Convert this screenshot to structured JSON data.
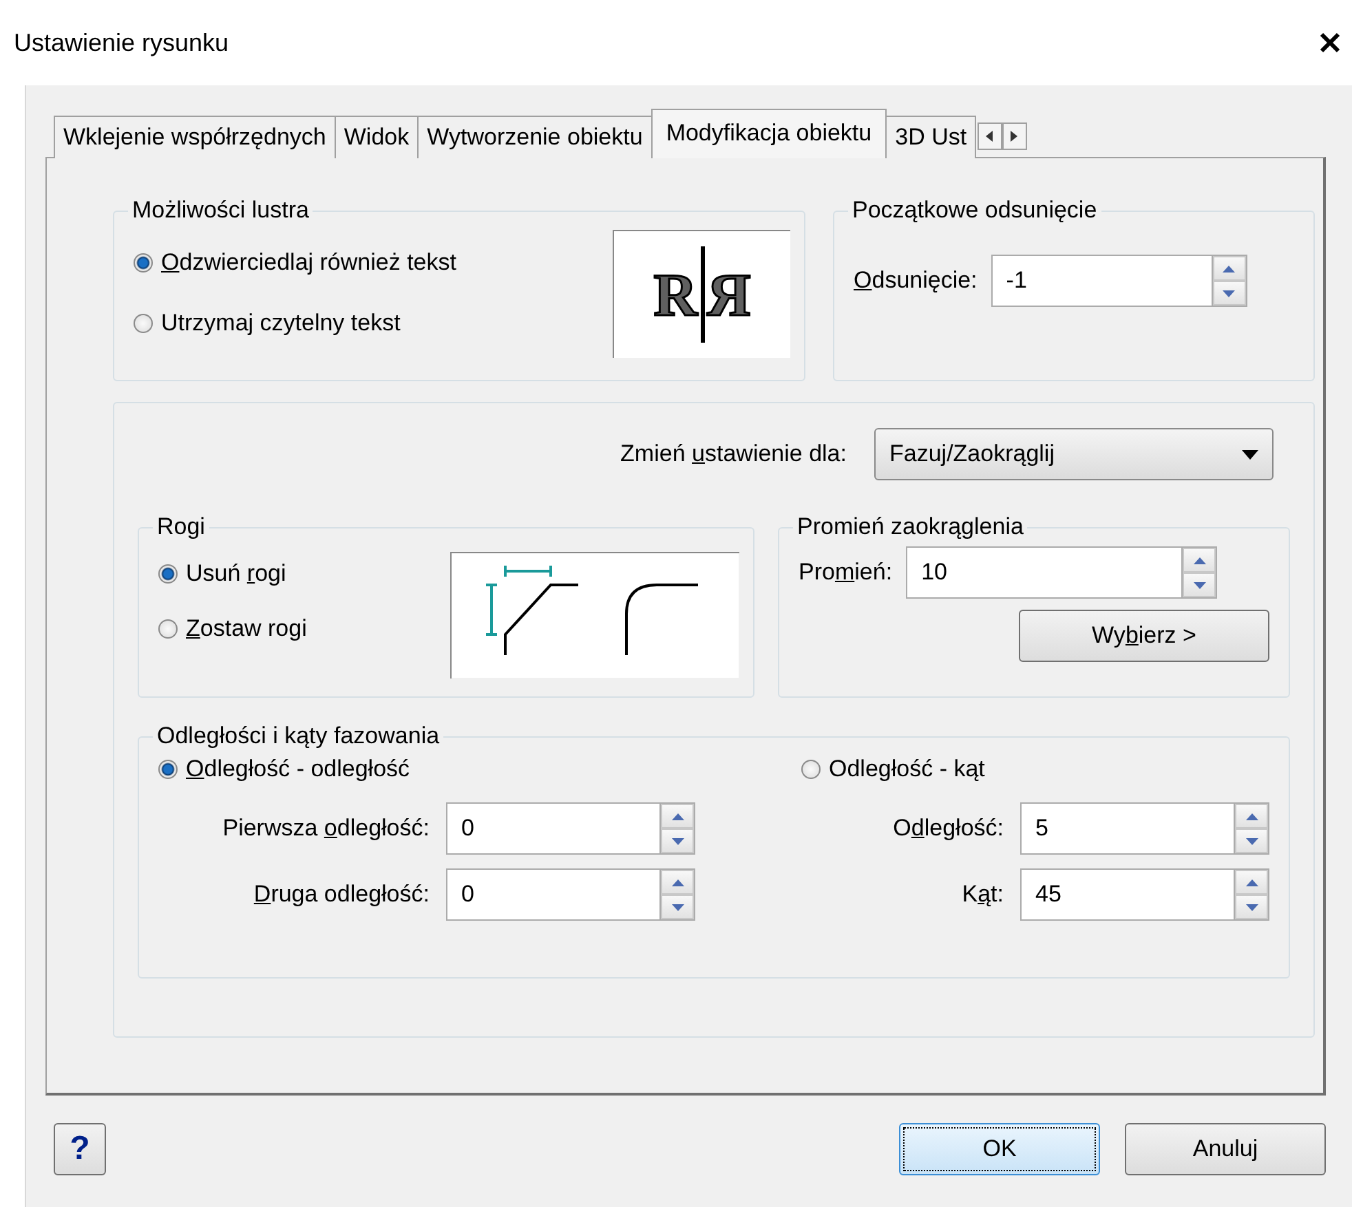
{
  "window": {
    "title": "Ustawienie rysunku"
  },
  "tabs": [
    {
      "label": "Wklejenie współrzędnych",
      "selected": false
    },
    {
      "label": "Widok",
      "selected": false
    },
    {
      "label": "Wytworzenie obiektu",
      "selected": false
    },
    {
      "label": "Modyfikacja obiektu",
      "selected": true
    },
    {
      "label": "3D Ust",
      "selected": false
    }
  ],
  "mirror": {
    "title": "Możliwości lustra",
    "options": [
      {
        "label": {
          "key": "O",
          "after": "dzwierciedlaj również tekst"
        },
        "selected": true
      },
      {
        "label": {
          "after": "Utrzymaj czytelny tekst"
        },
        "selected": false
      }
    ],
    "preview": [
      "R",
      "Я"
    ]
  },
  "offset": {
    "title": "Początkowe odsunięcie",
    "field": {
      "label": {
        "key": "O",
        "after": "dsunięcie:"
      },
      "value": "-1"
    }
  },
  "settings_for": {
    "label": {
      "before": "Zmień ",
      "key": "u",
      "after": "stawienie dla:"
    },
    "value": "Fazuj/Zaokrąglij"
  },
  "corners": {
    "title": "Rogi",
    "options": [
      {
        "label": {
          "before": "Usuń ",
          "key": "r",
          "after": "ogi"
        },
        "selected": true
      },
      {
        "label": {
          "key": "Z",
          "after": "ostaw rogi"
        },
        "selected": false
      }
    ]
  },
  "radius": {
    "title": "Promień zaokrąglenia",
    "field": {
      "label": {
        "before": "Pro",
        "key": "m",
        "after": "ień:"
      },
      "value": "10"
    },
    "pick_button": {
      "before": "Wy",
      "key": "b",
      "after": "ierz  >"
    }
  },
  "chamfer": {
    "title": "Odległości i kąty fazowania",
    "columns": [
      {
        "option": {
          "label": {
            "key": "O",
            "after": "dległość - odległość"
          },
          "selected": true
        },
        "fields": [
          {
            "label": {
              "before": "Pierwsza ",
              "key": "o",
              "after": "dległość:"
            },
            "value": "0"
          },
          {
            "label": {
              "key": "D",
              "after": "ruga odległość:"
            },
            "value": "0"
          }
        ]
      },
      {
        "option": {
          "label": {
            "after": "Odległość - kąt"
          },
          "selected": false
        },
        "fields": [
          {
            "label": {
              "before": "O",
              "key": "d",
              "after": "ległość:"
            },
            "value": "5"
          },
          {
            "label": {
              "before": "K",
              "key": "ą",
              "after": "t:"
            },
            "value": "45"
          }
        ]
      }
    ]
  },
  "buttons": {
    "help": "?",
    "ok": "OK",
    "cancel": "Anuluj"
  }
}
